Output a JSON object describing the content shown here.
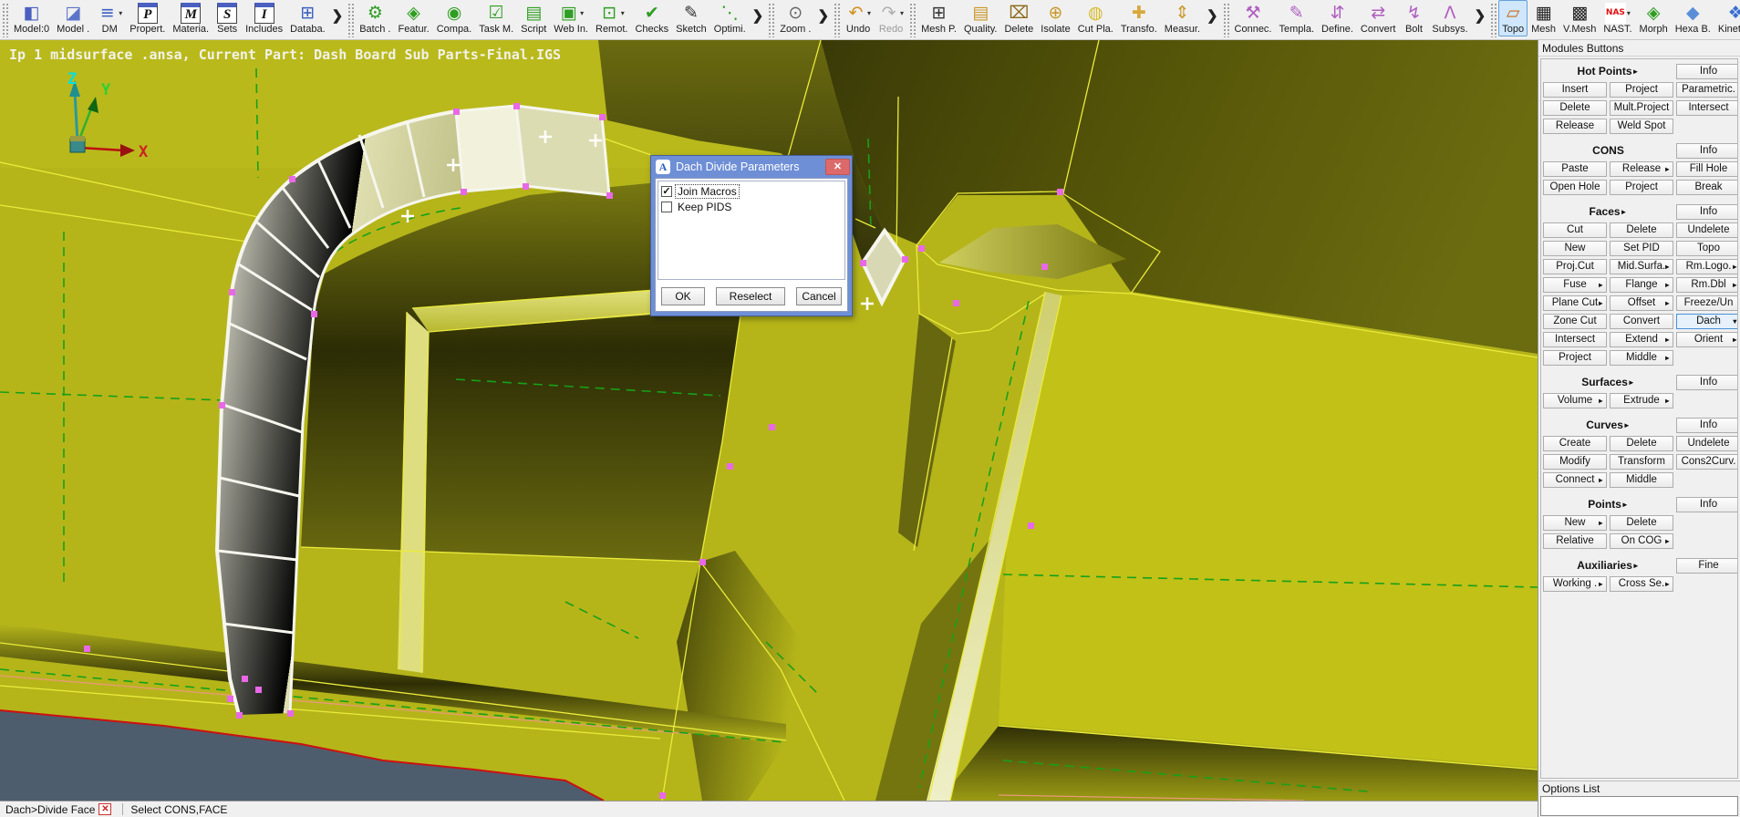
{
  "toolbar": {
    "groups": [
      {
        "items": [
          {
            "label": "Model:0",
            "name": "model-0",
            "glyph": "◧",
            "color": "#4a5fc0"
          },
          {
            "label": "Model .",
            "name": "model",
            "glyph": "◪",
            "color": "#5b74c9"
          },
          {
            "label": "DM",
            "name": "dm",
            "glyph": "≡",
            "color": "#3a5fc0",
            "dropdown": true
          },
          {
            "label": "Propert.",
            "name": "properties",
            "glyph": "P",
            "boxed": true
          },
          {
            "label": "Materia.",
            "name": "materials",
            "glyph": "M",
            "boxed": true
          },
          {
            "label": "Sets",
            "name": "sets",
            "glyph": "S",
            "boxed": true
          },
          {
            "label": "Includes",
            "name": "includes",
            "glyph": "I",
            "boxed": true
          },
          {
            "label": "Databa.",
            "name": "database",
            "glyph": "⊞",
            "color": "#3a5fc0"
          },
          {
            "overflow": true
          }
        ]
      },
      {
        "items": [
          {
            "label": "Batch .",
            "name": "batch",
            "glyph": "⚙",
            "color": "#2f9e23"
          },
          {
            "label": "Featur.",
            "name": "features",
            "glyph": "◈",
            "color": "#2f9e23"
          },
          {
            "label": "Compa.",
            "name": "compare",
            "glyph": "◉",
            "color": "#2f9e23"
          },
          {
            "label": "Task M.",
            "name": "task-manager",
            "glyph": "☑",
            "color": "#2f9e23"
          },
          {
            "label": "Script",
            "name": "script",
            "glyph": "▤",
            "color": "#2f9e23"
          },
          {
            "label": "Web In.",
            "name": "web-interface",
            "glyph": "▣",
            "color": "#2f9e23",
            "dropdown": true
          },
          {
            "label": "Remot.",
            "name": "remote",
            "glyph": "⊡",
            "color": "#2f9e23",
            "dropdown": true
          },
          {
            "label": "Checks",
            "name": "checks",
            "glyph": "✔",
            "color": "#2f9e23"
          },
          {
            "label": "Sketch",
            "name": "sketch",
            "glyph": "✎",
            "color": "#333333"
          },
          {
            "label": "Optimi.",
            "name": "optimization",
            "glyph": "⋱",
            "color": "#2f9e23"
          },
          {
            "overflow": true
          }
        ]
      },
      {
        "items": [
          {
            "label": "Zoom .",
            "name": "zoom",
            "glyph": "⊙",
            "color": "#666666"
          },
          {
            "overflow": true
          }
        ]
      },
      {
        "items": [
          {
            "label": "Undo",
            "name": "undo",
            "glyph": "↶",
            "color": "#d09018",
            "dropdown": true
          },
          {
            "label": "Redo",
            "name": "redo",
            "glyph": "↷",
            "color": "#b0b0b0",
            "dropdown": true,
            "disabled": true
          }
        ]
      },
      {
        "items": [
          {
            "label": "Mesh P.",
            "name": "mesh-parameters",
            "glyph": "⊞",
            "color": "#333333"
          },
          {
            "label": "Quality.",
            "name": "quality",
            "glyph": "▤",
            "color": "#c9982a"
          },
          {
            "label": "Delete",
            "name": "delete",
            "glyph": "⌧",
            "color": "#8a6a1a"
          },
          {
            "label": "Isolate",
            "name": "isolate",
            "glyph": "⊕",
            "color": "#c9982a"
          },
          {
            "label": "Cut Pla.",
            "name": "cut-plane",
            "glyph": "◍",
            "color": "#d5b929"
          },
          {
            "label": "Transfo.",
            "name": "transform",
            "glyph": "✚",
            "color": "#d8a83a"
          },
          {
            "label": "Measur.",
            "name": "measure",
            "glyph": "⇕",
            "color": "#c9982a"
          },
          {
            "overflow": true
          }
        ]
      },
      {
        "items": [
          {
            "label": "Connec.",
            "name": "connections",
            "glyph": "⚒",
            "color": "#b05fc0"
          },
          {
            "label": "Templa.",
            "name": "templates",
            "glyph": "✎",
            "color": "#b05fc0"
          },
          {
            "label": "Define.",
            "name": "define",
            "glyph": "⇵",
            "color": "#b05fc0"
          },
          {
            "label": "Convert",
            "name": "convert",
            "glyph": "⇄",
            "color": "#b05fc0"
          },
          {
            "label": "Bolt",
            "name": "bolt",
            "glyph": "↯",
            "color": "#b05fc0"
          },
          {
            "label": "Subsys.",
            "name": "subsystems",
            "glyph": "Λ",
            "color": "#b05fc0"
          },
          {
            "overflow": true
          }
        ]
      },
      {
        "items": [
          {
            "label": "Topo",
            "name": "topo",
            "glyph": "▱",
            "color": "#cc6a1a",
            "selected": true
          },
          {
            "label": "Mesh",
            "name": "mesh",
            "glyph": "▦",
            "color": "#222222"
          },
          {
            "label": "V.Mesh",
            "name": "volume-mesh",
            "glyph": "▩",
            "color": "#222222"
          },
          {
            "label": "NAST.",
            "name": "nastran",
            "nas": "NAS",
            "dropdown": true
          },
          {
            "label": "Morph",
            "name": "morph",
            "glyph": "◈",
            "color": "#2f9e23"
          },
          {
            "label": "Hexa B.",
            "name": "hexa-block",
            "glyph": "◆",
            "color": "#5a8fd8"
          },
          {
            "label": "Kinetics",
            "name": "kinetics",
            "glyph": "❖",
            "color": "#3a6fd0"
          },
          {
            "overflow": true
          }
        ]
      }
    ]
  },
  "viewport": {
    "header_text": "Ip 1 midsurface .ansa,  Current Part: Dash Board Sub Parts-Final.IGS",
    "axis": {
      "x": "X",
      "y": "Y",
      "z": "Z"
    }
  },
  "dialog": {
    "title": "Dach Divide Parameters",
    "icon_glyph": "A",
    "close_glyph": "✕",
    "checkboxes": [
      {
        "label": "Join Macros",
        "checked": true,
        "focused": true
      },
      {
        "label": "Keep PIDS",
        "checked": false,
        "focused": false
      }
    ],
    "buttons": [
      "OK",
      "Reselect",
      "Cancel"
    ]
  },
  "sidebar": {
    "title": "Modules Buttons",
    "options_title": "Options List",
    "sections": [
      {
        "title": "Hot Points",
        "arrow": true,
        "action": "Info",
        "rows": [
          [
            {
              "label": "Insert"
            },
            {
              "label": "Project"
            },
            {
              "label": "Parametric."
            }
          ],
          [
            {
              "label": "Delete"
            },
            {
              "label": "Mult.Project"
            },
            {
              "label": "Intersect"
            }
          ],
          [
            {
              "label": "Release"
            },
            {
              "label": "Weld Spot"
            },
            null
          ]
        ]
      },
      {
        "title": "CONS",
        "arrow": false,
        "action": "Info",
        "rows": [
          [
            {
              "label": "Paste"
            },
            {
              "label": "Release",
              "marker": "►"
            },
            {
              "label": "Fill Hole"
            }
          ],
          [
            {
              "label": "Open Hole"
            },
            {
              "label": "Project"
            },
            {
              "label": "Break"
            }
          ]
        ]
      },
      {
        "title": "Faces",
        "arrow": true,
        "action": "Info",
        "rows": [
          [
            {
              "label": "Cut"
            },
            {
              "label": "Delete"
            },
            {
              "label": "Undelete"
            }
          ],
          [
            {
              "label": "New"
            },
            {
              "label": "Set PID"
            },
            {
              "label": "Topo"
            }
          ],
          [
            {
              "label": "Proj.Cut"
            },
            {
              "label": "Mid.Surfa.",
              "marker": "►"
            },
            {
              "label": "Rm.Logo.",
              "marker": "►"
            }
          ],
          [
            {
              "label": "Fuse",
              "marker": "►"
            },
            {
              "label": "Flange",
              "marker": "►"
            },
            {
              "label": "Rm.Dbl",
              "marker": "►"
            }
          ],
          [
            {
              "label": "Plane Cut",
              "marker": "►"
            },
            {
              "label": "Offset",
              "marker": "►"
            },
            {
              "label": "Freeze/Un"
            }
          ],
          [
            {
              "label": "Zone Cut"
            },
            {
              "label": "Convert"
            },
            {
              "label": "Dach",
              "marker": "▼",
              "selected": true
            }
          ],
          [
            {
              "label": "Intersect"
            },
            {
              "label": "Extend",
              "marker": "►"
            },
            {
              "label": "Orient",
              "marker": "►"
            }
          ],
          [
            {
              "label": "Project"
            },
            {
              "label": "Middle",
              "marker": "►"
            },
            null
          ]
        ]
      },
      {
        "title": "Surfaces",
        "arrow": true,
        "action": "Info",
        "rows": [
          [
            {
              "label": "Volume",
              "marker": "►"
            },
            {
              "label": "Extrude",
              "marker": "►"
            },
            null
          ]
        ]
      },
      {
        "title": "Curves",
        "arrow": true,
        "action": "Info",
        "rows": [
          [
            {
              "label": "Create"
            },
            {
              "label": "Delete"
            },
            {
              "label": "Undelete"
            }
          ],
          [
            {
              "label": "Modify"
            },
            {
              "label": "Transform"
            },
            {
              "label": "Cons2Curv."
            }
          ],
          [
            {
              "label": "Connect",
              "marker": "►"
            },
            {
              "label": "Middle"
            },
            null
          ]
        ]
      },
      {
        "title": "Points",
        "arrow": true,
        "action": "Info",
        "rows": [
          [
            {
              "label": "New",
              "marker": "►"
            },
            {
              "label": "Delete"
            },
            null
          ],
          [
            {
              "label": "Relative"
            },
            {
              "label": "On COG",
              "marker": "►"
            },
            null
          ]
        ]
      },
      {
        "title": "Auxiliaries",
        "arrow": true,
        "action": "Fine",
        "rows": [
          [
            {
              "label": "Working .",
              "marker": "►"
            },
            {
              "label": "Cross Se.",
              "marker": "►"
            },
            null
          ]
        ]
      }
    ]
  },
  "statusbar": {
    "mode": "Dach>Divide Face",
    "close_glyph": "✕",
    "prompt": "Select CONS,FACE"
  },
  "colors": {
    "viewport_base": "#b5b51a",
    "selection_white": "#f4f4e4",
    "cons_green": "#18a018",
    "edge_yellow": "#ebeb3c",
    "free_edge_red": "#cc1111",
    "hot_point_magenta": "#e868e8",
    "background_navy": "#4e5d6e",
    "dialog_blue": "#6e8fd6"
  }
}
